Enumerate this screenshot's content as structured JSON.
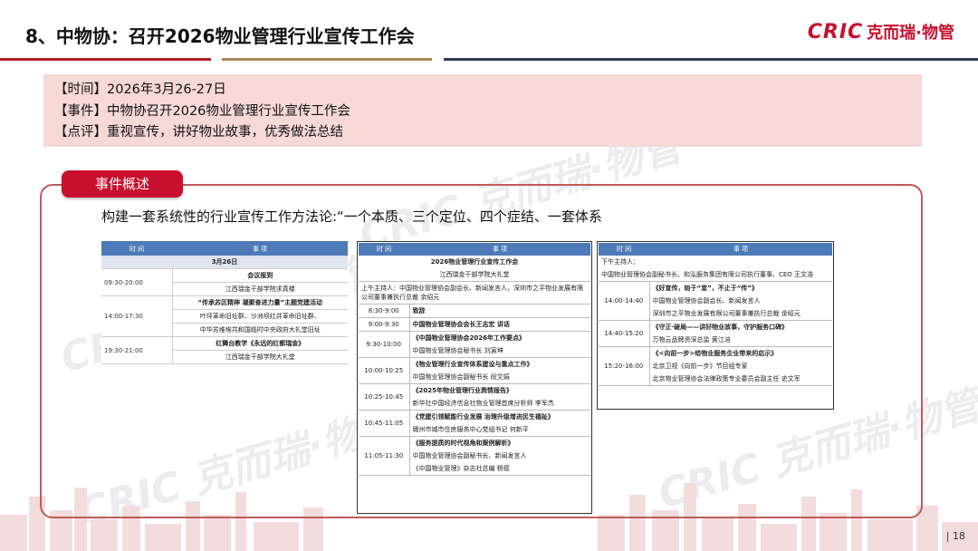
{
  "header": {
    "title": "8、中物协：召开2026物业管理行业宣传工作会",
    "logo_latin": "CRIC",
    "logo_cn": "克而瑞·物管"
  },
  "summary": {
    "time": "【时间】2026年3月26-27日",
    "event": "【事件】中物协召开2026物业管理行业宣传工作会",
    "comment": "【点评】重视宣传，讲好物业故事，优秀做法总结"
  },
  "section": {
    "tab_label": "事件概述",
    "intro": "构建一套系统性的行业宣传工作方法论:“一个本质、三个定位、四个症结、一套体系"
  },
  "table1": {
    "col_time": "时 间",
    "col_item": "事 项",
    "date": "3月26日",
    "rows": [
      {
        "time": "09:30-20:00",
        "title": "会议报到",
        "sub": "江西瑞金干部学院求真楼"
      },
      {
        "time": "14:00-17:30",
        "title": "“传承苏区精神 凝聚奋进力量”主题党建活动",
        "sub": "叶坪革命旧址群、沙洲坝红井革命旧址群、",
        "sub2": "中华苏维埃共和国临时中央政府大礼堂旧址"
      },
      {
        "time": "19:30-21:00",
        "title": "红舞台教学《永远的红都瑞金》",
        "sub": "江西瑞金干部学院大礼堂"
      }
    ]
  },
  "table2": {
    "col_time": "时 间",
    "col_item": "事 项",
    "title": "2026物业管理行业宣传工作会",
    "venue": "江西瑞金干部学院大礼堂",
    "host": "上午主持人：中国物业管理协会副会长、新闻发言人，深圳市之平物业发展有限公司董事兼执行总裁 余绍元",
    "rows": [
      {
        "time": "8:30-9:00",
        "title": "致辞",
        "sub": ""
      },
      {
        "time": "9:00-9:30",
        "title": "中国物业管理协会会长王志宏 讲话",
        "sub": ""
      },
      {
        "time": "9:30-10:00",
        "title": "《中国物业管理协会2026年工作要点》",
        "sub": "中国物业管理协会秘书长 刘寅坤"
      },
      {
        "time": "10:00-10:25",
        "title": "《物业管理行业宣传体系建设与重点工作》",
        "sub": "中国物业管理协会副秘书长 段文娟"
      },
      {
        "time": "10:25-10:45",
        "title": "《2025年物业管理行业舆情报告》",
        "sub": "新华社中国经济信息社物业管理首席分析师 李军杰"
      },
      {
        "time": "10:45-11:05",
        "title": "《党建引领赋能行业发展 治理升级增进民生福祉》",
        "sub": "赣州市城市住房服务中心党组书记 何新平"
      },
      {
        "time": "11:05-11:30",
        "title": "《服务提质的时代视角和案例解析》",
        "sub": "中国物业管理协会副秘书长、新闻发言人",
        "sub2": "《中国物业管理》杂志社总编 杨德"
      }
    ]
  },
  "table3": {
    "col_time": "时 间",
    "col_item": "事 项",
    "host_label": "下午主持人：",
    "host": "中国物业管理协会副秘书长、和泓服务集团有限公司执行董事、CEO 王文浩",
    "rows": [
      {
        "time": "14:00-14:40",
        "title": "《好宣传，始于“宣”，不止于“传”》",
        "sub": "中国物业管理协会副会长、新闻发言人",
        "sub2": "深圳市之平物业发展有限公司董事兼执行总裁 余绍元"
      },
      {
        "time": "14:40-15:20",
        "title": "《守正·破局——讲好物业故事，守护服务口碑》",
        "sub": "万物云品牌资深总监 黄江涪"
      },
      {
        "time": "15:20-16:00",
        "title": "《<向前一步>给物业服务企业带来的启示》",
        "sub": "北京卫视《向前一步》节目组专家",
        "sub2": "北京物业管理协会法律政策专业委员会副主任 史文军"
      }
    ]
  },
  "footer": {
    "page_number": "| 18"
  },
  "colors": {
    "brand_red": "#c8102e",
    "table_header_blue": "#4e7bb8",
    "summary_bg": "#f6d8d6"
  }
}
